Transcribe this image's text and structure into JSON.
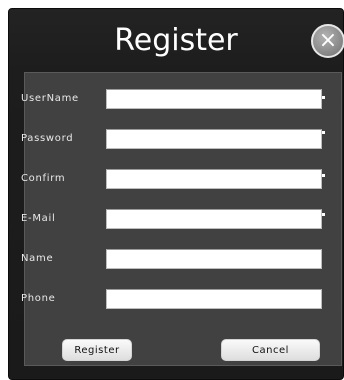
{
  "dialog": {
    "title": "Register",
    "close_glyph": "×"
  },
  "form": {
    "fields": [
      {
        "label": "UserName",
        "value": "",
        "required": true
      },
      {
        "label": "Password",
        "value": "",
        "required": true
      },
      {
        "label": "Confirm",
        "value": "",
        "required": true
      },
      {
        "label": "E-Mail",
        "value": "",
        "required": true
      },
      {
        "label": "Name",
        "value": "",
        "required": false
      },
      {
        "label": "Phone",
        "value": "",
        "required": false
      }
    ]
  },
  "buttons": {
    "register_label": "Register",
    "cancel_label": "Cancel"
  },
  "colors": {
    "dialog_bg": "#1d1d1d",
    "panel_bg": "#414141",
    "field_bg": "#ffffff",
    "text": "#ffffff"
  },
  "icons": {
    "close": "close-icon"
  }
}
